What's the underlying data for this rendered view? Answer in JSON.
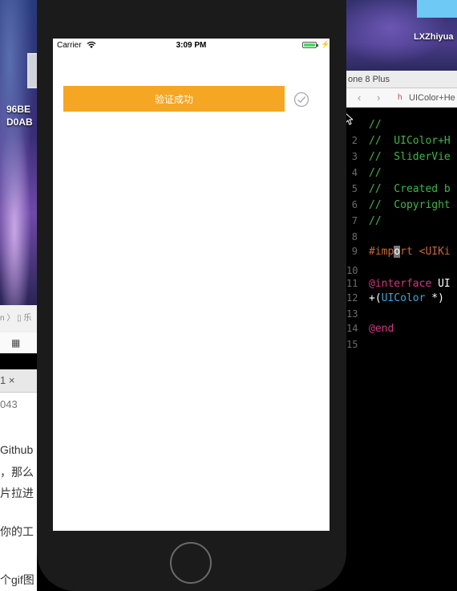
{
  "desktop": {
    "left_label_line1": "96BE",
    "left_label_line2": "D0AB",
    "user_label": "LXZhiyua"
  },
  "xcode": {
    "device_title": "one 8 Plus",
    "jumpbar_file": "UIColor+He",
    "code_lines": [
      {
        "num": "",
        "parts": [
          {
            "t": "//",
            "c": "c-comment"
          }
        ]
      },
      {
        "num": "2",
        "parts": [
          {
            "t": "//  UIColor+H",
            "c": "c-comment"
          }
        ]
      },
      {
        "num": "3",
        "parts": [
          {
            "t": "//  SliderVie",
            "c": "c-comment"
          }
        ]
      },
      {
        "num": "4",
        "parts": [
          {
            "t": "//",
            "c": "c-comment"
          }
        ]
      },
      {
        "num": "5",
        "parts": [
          {
            "t": "//  Created b",
            "c": "c-comment"
          }
        ]
      },
      {
        "num": "6",
        "parts": [
          {
            "t": "//  Copyright",
            "c": "c-comment"
          }
        ]
      },
      {
        "num": "7",
        "parts": [
          {
            "t": "//",
            "c": "c-comment"
          }
        ]
      },
      {
        "num": "8",
        "parts": []
      },
      {
        "num": "9",
        "parts": [
          {
            "t": "#imp",
            "c": "c-directive"
          },
          {
            "t": "o",
            "c": "c-directive caret"
          },
          {
            "t": "rt ",
            "c": "c-directive"
          },
          {
            "t": "<UIKi",
            "c": "c-directive"
          }
        ]
      },
      {
        "num": "10",
        "parts": []
      },
      {
        "num": "11",
        "parts": [
          {
            "t": "@interface",
            "c": "c-keyword"
          },
          {
            "t": " UI",
            "c": "c-plain"
          }
        ]
      },
      {
        "num": "12",
        "parts": [
          {
            "t": "+(",
            "c": "c-plain"
          },
          {
            "t": "UIColor",
            "c": "c-type"
          },
          {
            "t": " *)",
            "c": "c-plain"
          }
        ]
      },
      {
        "num": "13",
        "parts": []
      },
      {
        "num": "14",
        "parts": [
          {
            "t": "@end",
            "c": "c-keyword"
          }
        ]
      },
      {
        "num": "15",
        "parts": []
      }
    ]
  },
  "left_panel": {
    "breadcrumb": "n 〉 ▯ 乐",
    "tab_label": "1 ×",
    "number": "043",
    "text_lines": [
      "Github",
      "，那么",
      "片拉进",
      "你的工",
      "个gif图"
    ]
  },
  "simulator": {
    "status": {
      "carrier": "Carrier",
      "time": "3:09 PM",
      "battery_level": 1.0
    },
    "verify_button_label": "验证成功",
    "icons": {
      "wifi": "wifi-icon",
      "battery": "battery-icon",
      "success": "checkmark-circle-icon",
      "home": "home-button"
    },
    "colors": {
      "button": "#f5a623",
      "check": "#aaaaaa"
    }
  }
}
